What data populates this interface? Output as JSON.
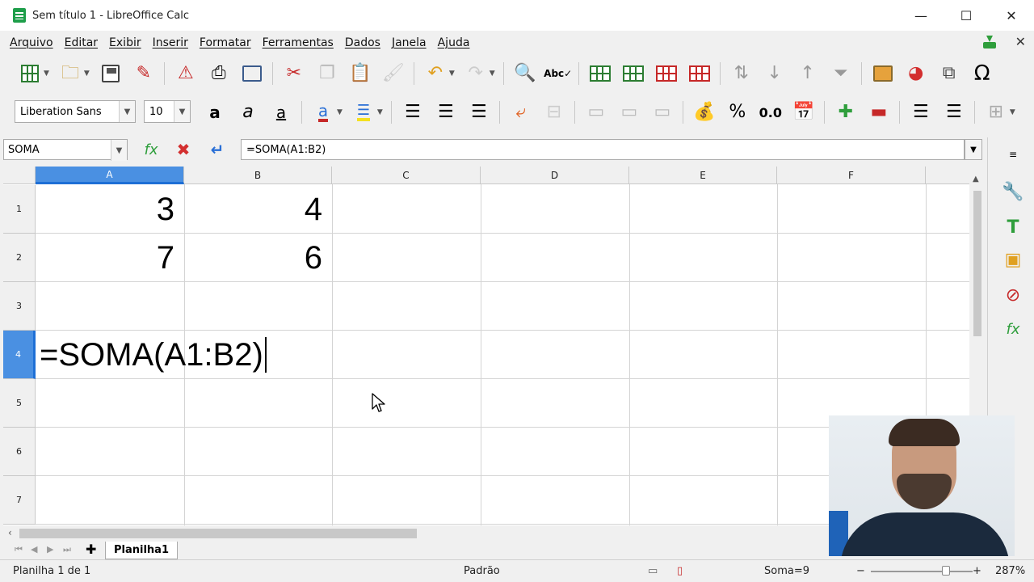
{
  "window": {
    "title": "Sem título 1 - LibreOffice Calc",
    "minimize": "—",
    "maximize": "☐",
    "close": "✕"
  },
  "menu": {
    "items": [
      "Arquivo",
      "Editar",
      "Exibir",
      "Inserir",
      "Formatar",
      "Ferramentas",
      "Dados",
      "Janela",
      "Ajuda"
    ],
    "close_doc": "✕"
  },
  "formatting": {
    "font_name": "Liberation Sans",
    "font_size": "10",
    "percent": "%",
    "decimal": "0.0"
  },
  "formula_bar": {
    "name_box": "SOMA",
    "content": "=SOMA(A1:B2)"
  },
  "sheet": {
    "columns": [
      "A",
      "B",
      "C",
      "D",
      "E",
      "F"
    ],
    "active_column": "A",
    "rows": [
      "1",
      "2",
      "3",
      "4",
      "5",
      "6",
      "7"
    ],
    "active_row": "4",
    "cells": {
      "A1": "3",
      "B1": "4",
      "A2": "7",
      "B2": "6",
      "A4_editing": "=SOMA(A1:B2)"
    }
  },
  "tabs": {
    "add": "✚",
    "sheets": [
      "Planilha1"
    ]
  },
  "status": {
    "sheet_info": "Planilha 1 de 1",
    "page_style": "Padrão",
    "sum": "Soma=9",
    "zoom": "287%",
    "zoom_minus": "−",
    "zoom_plus": "+"
  },
  "colors": {
    "accent": "#4a90e2",
    "calc_green": "#1e9e4a"
  }
}
